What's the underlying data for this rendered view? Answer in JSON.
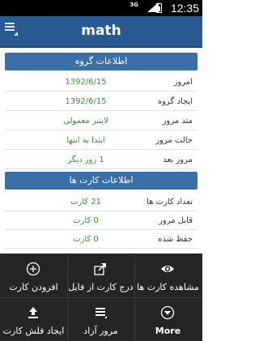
{
  "status": {
    "time": "12:35",
    "network": "3G"
  },
  "actionbar": {
    "title": "math",
    "menu_icon": "drawer-menu-icon"
  },
  "group_section": {
    "header": "اطلاعات گروه",
    "rows": [
      {
        "label": "امروز",
        "value": "1392/6/15"
      },
      {
        "label": "ایجاد گروه",
        "value": "1392/6/15"
      },
      {
        "label": "متد مرور",
        "value": "لایتنر معمولی"
      },
      {
        "label": "حالت مرور",
        "value": "ابتدا به انتها"
      },
      {
        "label": "مرور بعد",
        "value": "1 روز دیگر"
      }
    ]
  },
  "cards_section": {
    "header": "اطلاعات کارت ها",
    "rows": [
      {
        "label": "تعداد کارت ها",
        "value": "21 کارت"
      },
      {
        "label": "قابل مرور",
        "value": "0 کارت"
      },
      {
        "label": "حفظ شده",
        "value": "0 کارت"
      }
    ]
  },
  "menu": {
    "items": [
      {
        "label": "افزودن کارت",
        "icon": "add-circle-icon"
      },
      {
        "label": "درج کارت از فایل",
        "icon": "share-icon"
      },
      {
        "label": "مشاهده کارت ها",
        "icon": "eye-icon"
      },
      {
        "label": "ایجاد فلش کارت",
        "icon": "upload-icon"
      },
      {
        "label": "مرور آزاد",
        "icon": "list-icon"
      },
      {
        "label": "More",
        "icon": "more-chevron-icon"
      }
    ]
  }
}
